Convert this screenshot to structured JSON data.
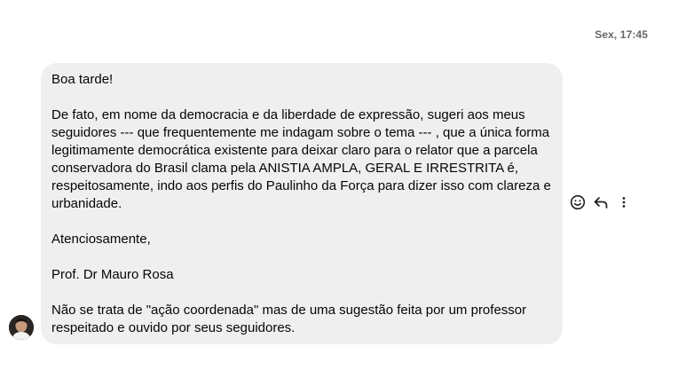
{
  "header": {
    "timestamp": "Sex, 17:45"
  },
  "message": {
    "greeting": "Boa tarde!",
    "paragraph1": "De fato, em nome da democracia e da liberdade de expressão, sugeri aos meus seguidores --- que frequentemente me indagam sobre o tema --- , que a única forma legitimamente democrática existente para deixar claro para o relator que a parcela conservadora do Brasil clama pela ANISTIA AMPLA, GERAL E IRRESTRITA é, respeitosamente, indo aos perfis do Paulinho da Força para dizer isso com clareza e urbanidade.",
    "closing": "Atenciosamente,",
    "signature": "Prof. Dr Mauro Rosa",
    "paragraph2": "Não se trata de \"ação coordenada\" mas de uma sugestão feita por um professor respeitado e ouvido por seus seguidores."
  },
  "actions": {
    "icons": [
      "smiley-icon",
      "reply-icon",
      "more-vertical-icon"
    ]
  },
  "colors": {
    "bubble": "#efefef",
    "text": "#050505",
    "timestamp": "#65676b"
  }
}
